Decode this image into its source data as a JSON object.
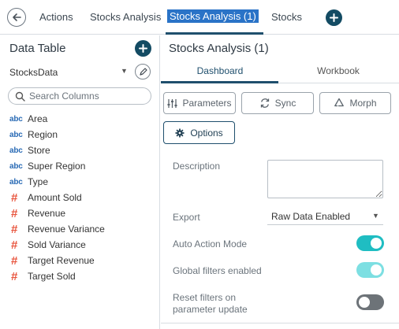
{
  "topbar": {
    "back_icon": "arrow-left-icon",
    "tabs": [
      {
        "label": "Actions"
      },
      {
        "label": "Stocks Analysis"
      },
      {
        "label": "Stocks Analysis (1)",
        "active": true
      },
      {
        "label": "Stocks"
      }
    ],
    "add_icon": "plus-icon"
  },
  "data_table": {
    "title": "Data Table",
    "source": "StocksData",
    "search_placeholder": "Search Columns",
    "columns": [
      {
        "type": "abc",
        "name": "Area"
      },
      {
        "type": "abc",
        "name": "Region"
      },
      {
        "type": "abc",
        "name": "Store"
      },
      {
        "type": "abc",
        "name": "Super Region"
      },
      {
        "type": "abc",
        "name": "Type"
      },
      {
        "type": "#",
        "name": "Amount Sold"
      },
      {
        "type": "#",
        "name": "Revenue"
      },
      {
        "type": "#",
        "name": "Revenue Variance"
      },
      {
        "type": "#",
        "name": "Sold Variance"
      },
      {
        "type": "#",
        "name": "Target Revenue"
      },
      {
        "type": "#",
        "name": "Target Sold"
      }
    ]
  },
  "settings": {
    "title": "Stocks Analysis (1)",
    "tabs": [
      "Dashboard",
      "Workbook"
    ],
    "buttons": {
      "parameters": "Parameters",
      "sync": "Sync",
      "morph": "Morph",
      "options": "Options"
    },
    "description_label": "Description",
    "description_value": "",
    "export_label": "Export",
    "export_value": "Raw Data Enabled",
    "auto_action_label": "Auto Action Mode",
    "auto_action_on": true,
    "global_filters_label": "Global filters enabled",
    "global_filters_on": true,
    "reset_filters_label_1": "Reset filters on",
    "reset_filters_label_2": "parameter update",
    "reset_filters_on": false
  },
  "colors": {
    "accent": "#1f4f6d",
    "active_tab_bg": "#2a73c7",
    "toggle_on": "#1fbdc2",
    "toggle_off": "#6d7378",
    "number_type": "#e8553e",
    "text_type": "#2a6bb5"
  }
}
